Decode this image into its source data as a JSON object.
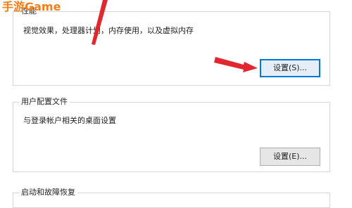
{
  "watermark": {
    "text": "手游Game",
    "color": "#f07f1c"
  },
  "performance": {
    "label": "性能",
    "description": "视觉效果，处理器计划，内存使用，以及虚拟内存",
    "settings_button": "设置(S)..."
  },
  "user_profiles": {
    "label": "用户配置文件",
    "description": "与登录帐户相关的桌面设置",
    "settings_button": "设置(E)..."
  },
  "startup_recovery": {
    "label": "启动和故障恢复"
  },
  "colors": {
    "arrow": "#e0282e",
    "focus_border": "#0078d7"
  },
  "icons": [
    "red-arrow-annotation"
  ]
}
